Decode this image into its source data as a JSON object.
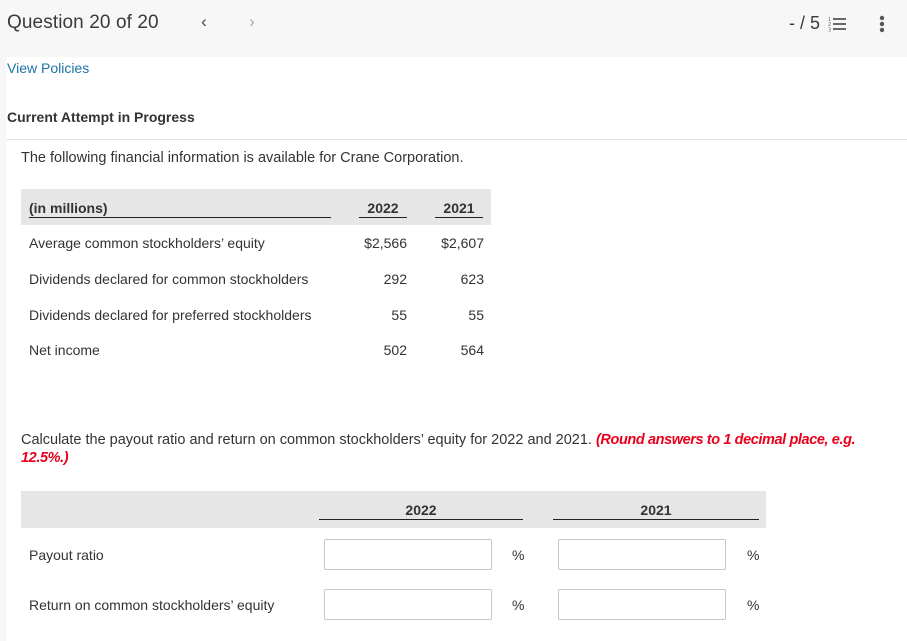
{
  "header": {
    "question_label": "Question 20 of 20",
    "prev_icon": "‹",
    "next_icon": "›",
    "score": "- / 5",
    "list_icon": "numbered-list-icon",
    "more_icon": "more-vertical-icon"
  },
  "links": {
    "view_policies": "View Policies"
  },
  "attempt_label": "Current Attempt in Progress",
  "intro": "The following financial information is available for Crane Corporation.",
  "info_table": {
    "headers": [
      "(in millions)",
      "2022",
      "2021"
    ],
    "rows": [
      {
        "label": "Average common stockholders’ equity",
        "v2022": "$2,566",
        "v2021": "$2,607"
      },
      {
        "label": "Dividends declared for common stockholders",
        "v2022": "292",
        "v2021": "623"
      },
      {
        "label": "Dividends declared for preferred stockholders",
        "v2022": "55",
        "v2021": "55"
      },
      {
        "label": "Net income",
        "v2022": "502",
        "v2021": "564"
      }
    ]
  },
  "instruction": {
    "text": "Calculate the payout ratio and return on common stockholders’ equity for 2022 and 2021. ",
    "emphasis": "(Round answers to 1 decimal place, e.g. 12.5%.)",
    "emphasis_color": "#e8001c"
  },
  "answer_table": {
    "headers": [
      "2022",
      "2021"
    ],
    "unit": "%",
    "rows": [
      {
        "label": "Payout ratio",
        "v2022": "",
        "v2021": ""
      },
      {
        "label": "Return on common stockholders’ equity",
        "v2022": "",
        "v2021": ""
      }
    ]
  },
  "colors": {
    "link": "#1a73a8",
    "header_bg": "#e6e6e6",
    "topbar_bg": "#f7f7f7"
  }
}
